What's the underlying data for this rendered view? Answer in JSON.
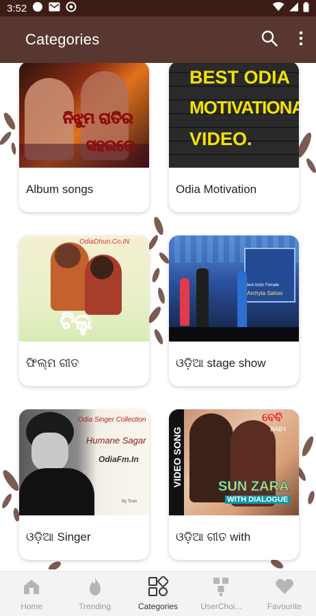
{
  "status": {
    "time": "3:52",
    "left_icons": [
      "record-icon",
      "gmail-icon",
      "sync-icon"
    ],
    "right_icons": [
      "wifi-icon",
      "signal-icon",
      "battery-icon"
    ]
  },
  "app_bar": {
    "title": "Categories",
    "actions": [
      "search-icon",
      "more-vertical-icon"
    ],
    "color": "#573730"
  },
  "categories": [
    {
      "label": "Album songs",
      "thumb_text": [
        "ନିଝୁମ ରାତିର",
        "ସହରରେ"
      ]
    },
    {
      "label": "Odia Motivation",
      "thumb_text": [
        "BEST ODIA",
        "MOTIVATIONAL",
        "VIDEO."
      ]
    },
    {
      "label": "ଫିଲ୍ମ ଗୀତ",
      "thumb_text": [
        "OdiaDhun.Co.IN",
        "ଟିଲୁ"
      ]
    },
    {
      "label": "ଓଡ଼ିଆ  stage show",
      "thumb_text": [
        "Best Actor Female",
        "Archyta Sahoo"
      ]
    },
    {
      "label": "ଓଡ଼ିଆ  Singer",
      "thumb_text": [
        "Odia Singer Collection",
        "Humane Sagar",
        "OdiaFm.In",
        "By Tiran"
      ]
    },
    {
      "label": "ଓଡ଼ିଆ  ଗୀତ with",
      "thumb_text": [
        "VIDEO SONG",
        "ବେବି",
        "BABY",
        "SUN ZARA",
        "WITH DIALOGUE"
      ]
    }
  ],
  "bottom_nav": [
    {
      "label": "Home",
      "icon": "home-icon",
      "active": false
    },
    {
      "label": "Trending",
      "icon": "flame-icon",
      "active": false
    },
    {
      "label": "Categories",
      "icon": "categories-icon",
      "active": true
    },
    {
      "label": "UserChoi...",
      "icon": "user-choice-icon",
      "active": false
    },
    {
      "label": "Favourite",
      "icon": "heart-icon",
      "active": false
    }
  ]
}
